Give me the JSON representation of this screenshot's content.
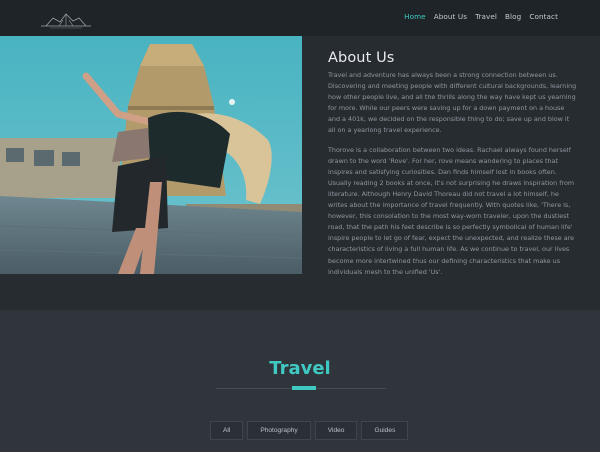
{
  "nav": {
    "logo_icon": "temple-logo-icon",
    "items": [
      {
        "label": "Home",
        "active": true
      },
      {
        "label": "About Us",
        "active": false
      },
      {
        "label": "Travel",
        "active": false
      },
      {
        "label": "Blog",
        "active": false
      },
      {
        "label": "Contact",
        "active": false
      }
    ]
  },
  "about": {
    "title": "About Us",
    "paragraphs": [
      "Travel and adventure has always been a strong connection between us. Discovering and meeting people with different cultural backgrounds, learning how other people live, and all the thrills along the way have kept us yearning for more. While our peers were saving up for a down payment on a house and a 401k, we decided on the responsible thing to do; save up and blow it all on a yearlong travel experience.",
      "Thorove is a collaboration between two ideas. Rachael always found herself drawn to the word 'Rove'. For her, rove means wandering to places that inspires and satisfying curiosities. Dan finds himself lost in books often. Usually reading 2 books at once, it's not surprising he draws inspiration from literature. Although Henry David Thoreau did not travel a lot himself, he writes about the importance of travel frequently. With quotes like, 'There is, however, this consolation to the most way-worn traveler, upon the dustiest road, that the path his feet describe is so perfectly symbolical of human life' inspire people to let go of fear, expect the unexpected, and realize these are characteristics of living a full human life. As we continue to travel, our lives become more intertwined thus our defining characteristics that make us individuals mesh to the unified 'Us'."
    ]
  },
  "travel": {
    "title": "Travel",
    "filters": [
      "All",
      "Photography",
      "Video",
      "Guides"
    ]
  },
  "colors": {
    "accent": "#3fc9c2",
    "navbar": "#1f2428",
    "about_bg": "#272c31",
    "travel_bg": "#2f353b"
  }
}
